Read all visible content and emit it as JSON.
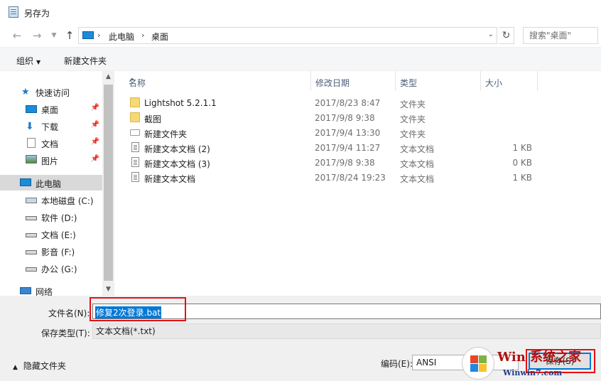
{
  "window": {
    "title": "另存为"
  },
  "nav": {
    "breadcrumb": [
      "此电脑",
      "桌面"
    ],
    "search_placeholder": "搜索\"桌面\""
  },
  "toolbar": {
    "organize": "组织",
    "new_folder": "新建文件夹"
  },
  "sidebar": {
    "quick_access": "快速访问",
    "items": [
      {
        "label": "桌面"
      },
      {
        "label": "下载"
      },
      {
        "label": "文档"
      },
      {
        "label": "图片"
      }
    ],
    "this_pc": "此电脑",
    "drives": [
      {
        "label": "本地磁盘 (C:)"
      },
      {
        "label": "软件 (D:)"
      },
      {
        "label": "文档 (E:)"
      },
      {
        "label": "影音 (F:)"
      },
      {
        "label": "办公 (G:)"
      }
    ],
    "network": "网络"
  },
  "columns": {
    "name": "名称",
    "modified": "修改日期",
    "type": "类型",
    "size": "大小"
  },
  "files": [
    {
      "name": "Lightshot 5.2.1.1",
      "modified": "2017/8/23 8:47",
      "type": "文件夹",
      "size": "",
      "icon": "folder-icon"
    },
    {
      "name": "截图",
      "modified": "2017/9/8 9:38",
      "type": "文件夹",
      "size": "",
      "icon": "folder-icon"
    },
    {
      "name": "新建文件夹",
      "modified": "2017/9/4 13:30",
      "type": "文件夹",
      "size": "",
      "icon": "empty-folder-icon"
    },
    {
      "name": "新建文本文档 (2)",
      "modified": "2017/9/4 11:27",
      "type": "文本文档",
      "size": "1 KB",
      "icon": "text-file-icon"
    },
    {
      "name": "新建文本文档 (3)",
      "modified": "2017/9/8 9:38",
      "type": "文本文档",
      "size": "0 KB",
      "icon": "text-file-icon"
    },
    {
      "name": "新建文本文档",
      "modified": "2017/8/24 19:23",
      "type": "文本文档",
      "size": "1 KB",
      "icon": "text-file-icon"
    }
  ],
  "form": {
    "filename_label": "文件名(N):",
    "filename_value": "修复2次登录.bat",
    "filetype_label": "保存类型(T):",
    "filetype_value": "文本文档(*.txt)",
    "hide_folders": "隐藏文件夹",
    "encoding_label": "编码(E):",
    "encoding_value": "ANSI",
    "save_label": "保存(S)"
  },
  "watermark": {
    "brand": "Win 系统之家",
    "site": "Winwin7.com"
  },
  "colors": {
    "accent": "#0078d7",
    "highlight_box": "#e81010",
    "folder": "#f8d775"
  }
}
